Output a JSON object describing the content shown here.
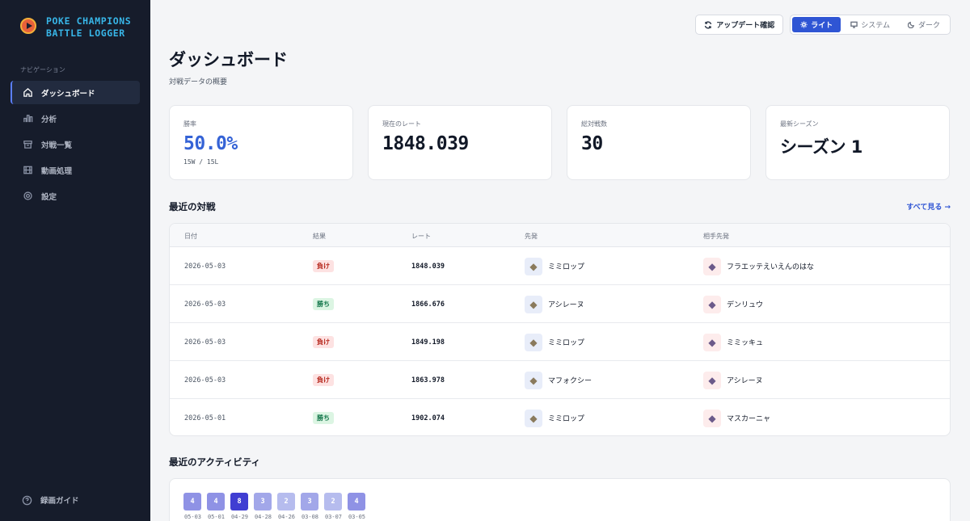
{
  "app": {
    "brand_line1": "POKE CHAMPIONS",
    "brand_line2": "BATTLE LOGGER"
  },
  "sidebar": {
    "section_label": "ナビゲーション",
    "items": [
      {
        "label": "ダッシュボード",
        "icon": "home-icon",
        "active": true
      },
      {
        "label": "分析",
        "icon": "bar-chart-icon",
        "active": false
      },
      {
        "label": "対戦一覧",
        "icon": "archive-icon",
        "active": false
      },
      {
        "label": "動画処理",
        "icon": "film-icon",
        "active": false
      },
      {
        "label": "設定",
        "icon": "gear-icon",
        "active": false
      }
    ],
    "guide_label": "録画ガイド"
  },
  "topbar": {
    "update_label": "アップデート確認",
    "themes": [
      {
        "label": "ライト",
        "icon": "sun-icon",
        "active": true
      },
      {
        "label": "システム",
        "icon": "monitor-icon",
        "active": false
      },
      {
        "label": "ダーク",
        "icon": "moon-icon",
        "active": false
      }
    ]
  },
  "header": {
    "title": "ダッシュボード",
    "subtitle": "対戦データの概要"
  },
  "stats": [
    {
      "label": "勝率",
      "value": "50.0%",
      "sub": "15W / 15L"
    },
    {
      "label": "現在のレート",
      "value": "1848.039"
    },
    {
      "label": "総対戦数",
      "value": "30"
    },
    {
      "label": "最新シーズン",
      "value": "シーズン 1"
    }
  ],
  "recent": {
    "title": "最近の対戦",
    "see_all": "すべて見る →",
    "columns": [
      "日付",
      "結果",
      "レート",
      "先発",
      "相手先発"
    ],
    "rows": [
      {
        "date": "2026-05-03",
        "result": "負け",
        "result_type": "lose",
        "rate": "1848.039",
        "lead": "ミミロップ",
        "opp": "フラエッテえいえんのはな"
      },
      {
        "date": "2026-05-03",
        "result": "勝ち",
        "result_type": "win",
        "rate": "1866.676",
        "lead": "アシレーヌ",
        "opp": "デンリュウ"
      },
      {
        "date": "2026-05-03",
        "result": "負け",
        "result_type": "lose",
        "rate": "1849.198",
        "lead": "ミミロップ",
        "opp": "ミミッキュ"
      },
      {
        "date": "2026-05-03",
        "result": "負け",
        "result_type": "lose",
        "rate": "1863.978",
        "lead": "マフォクシー",
        "opp": "アシレーヌ"
      },
      {
        "date": "2026-05-01",
        "result": "勝ち",
        "result_type": "win",
        "rate": "1902.074",
        "lead": "ミミロップ",
        "opp": "マスカーニャ"
      }
    ]
  },
  "activity": {
    "title": "最近のアクティビティ",
    "days": [
      {
        "count": 4,
        "date": "05-03"
      },
      {
        "count": 4,
        "date": "05-01"
      },
      {
        "count": 8,
        "date": "04-29"
      },
      {
        "count": 3,
        "date": "04-28"
      },
      {
        "count": 2,
        "date": "04-26"
      },
      {
        "count": 3,
        "date": "03-08"
      },
      {
        "count": 2,
        "date": "03-07"
      },
      {
        "count": 4,
        "date": "03-05"
      }
    ]
  },
  "colors": {
    "accent": "#2f55d4",
    "win_rate": "#3563d6",
    "sidebar_bg": "#161c2b",
    "brand": "#38b6e8"
  }
}
